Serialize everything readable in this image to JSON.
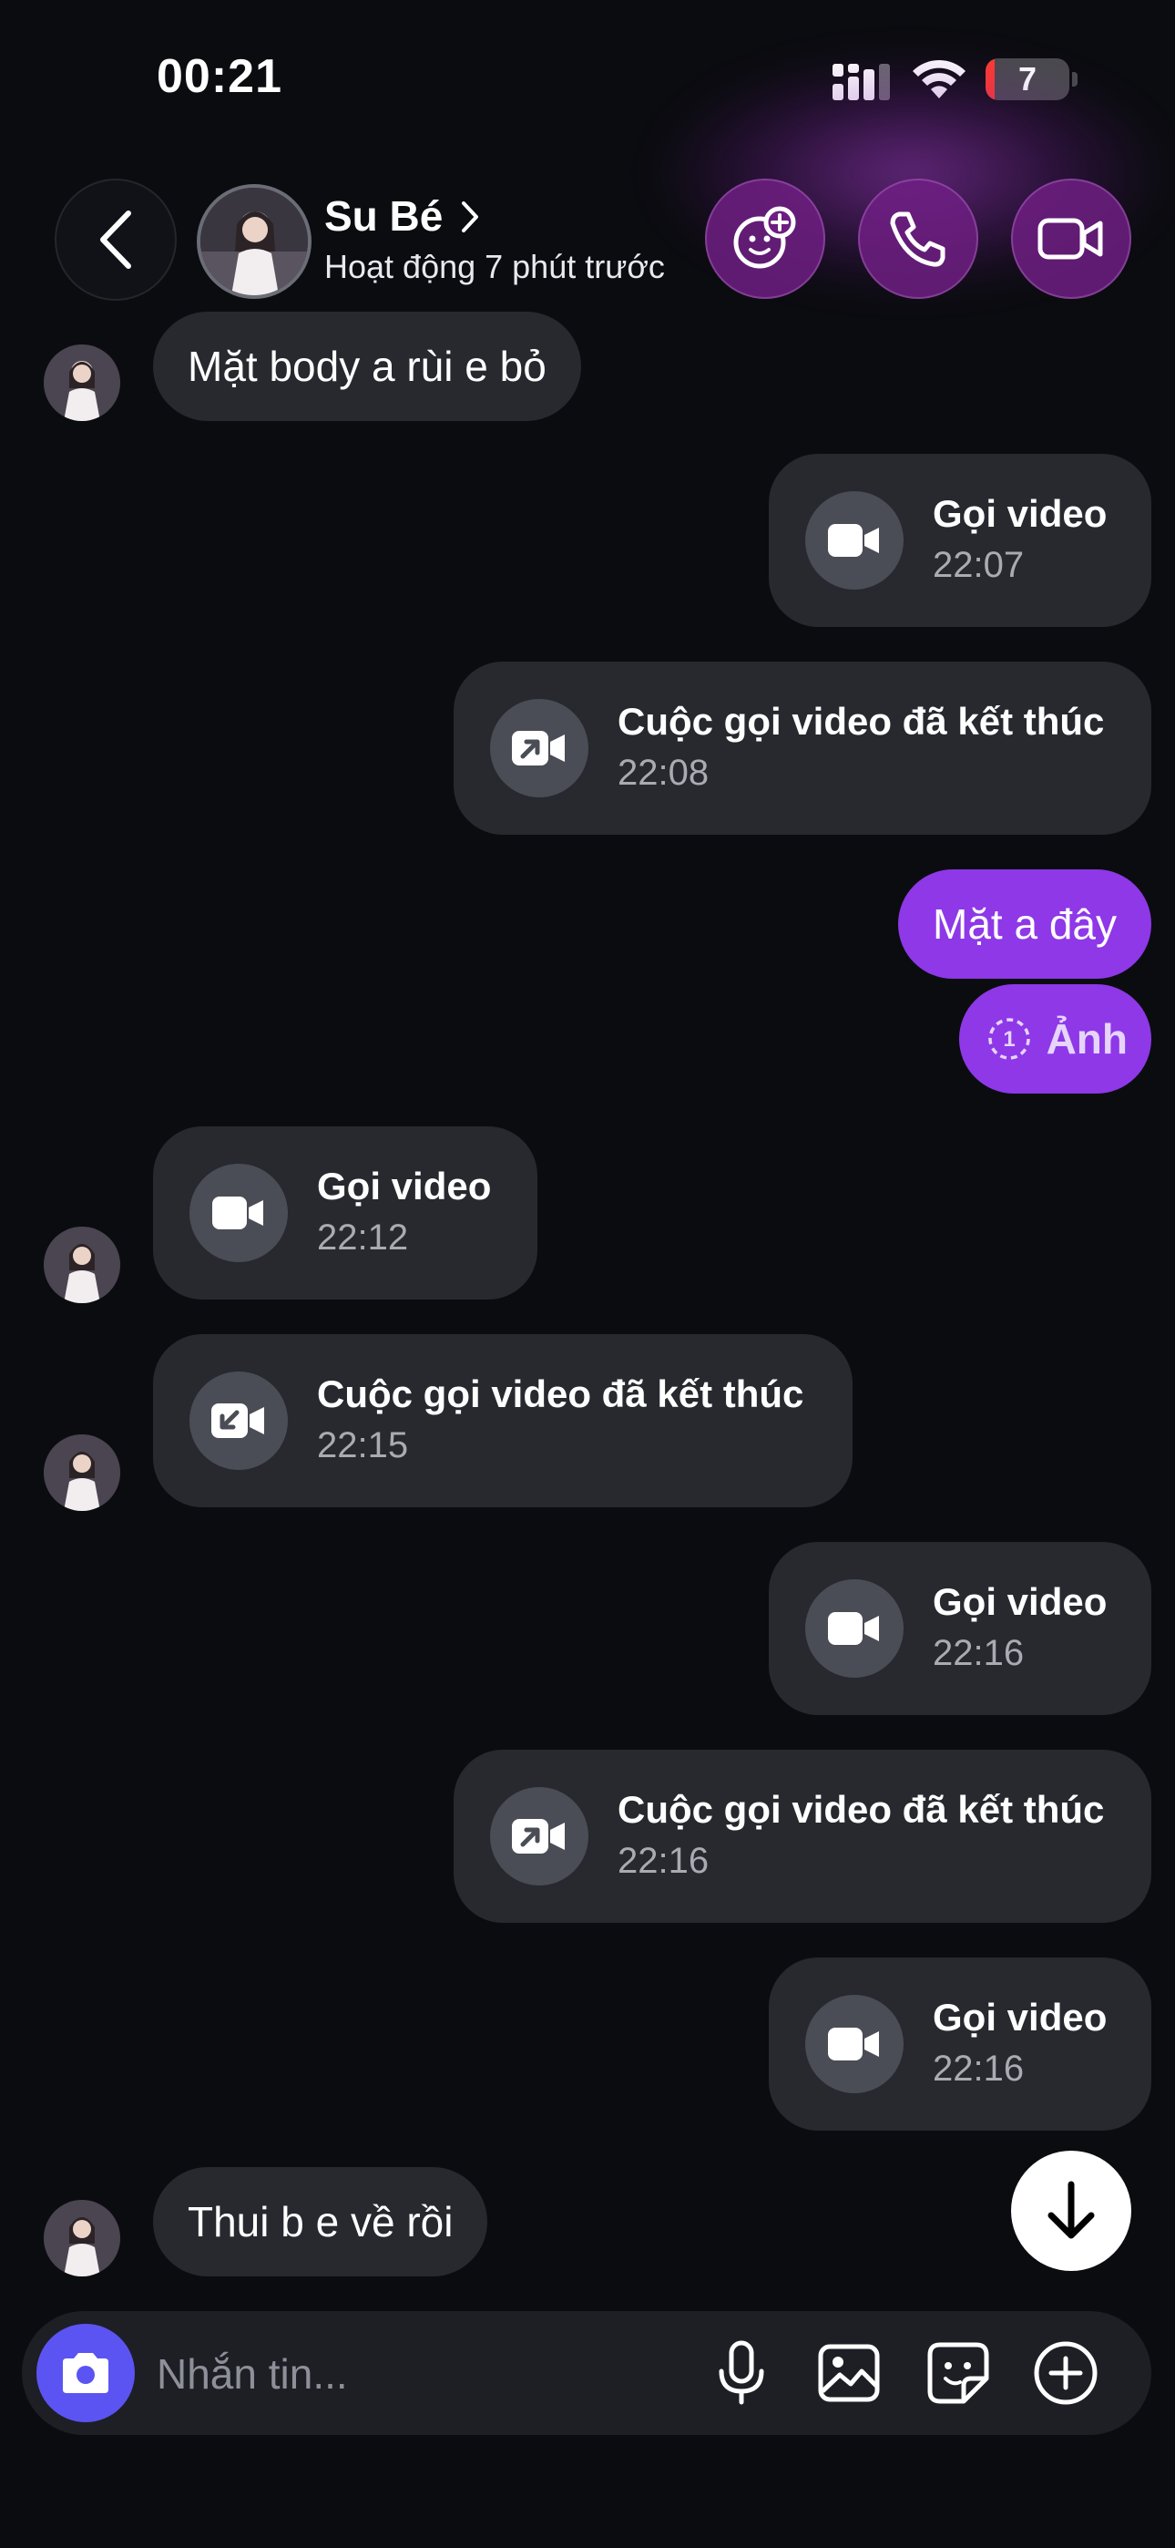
{
  "status_bar": {
    "time": "00:21",
    "battery_level": "7"
  },
  "header": {
    "name": "Su Bé",
    "status": "Hoạt động 7 phút trước"
  },
  "messages": {
    "m1": {
      "text": "Mặt body a rùi e bỏ"
    },
    "m2": {
      "title": "Gọi video",
      "time": "22:07",
      "icon": "video-camera-icon"
    },
    "m3": {
      "title": "Cuộc gọi video đã kết thúc",
      "time": "22:08",
      "icon": "outgoing-video-call-icon"
    },
    "m4": {
      "text": "Mặt a đây"
    },
    "m5": {
      "text": "Ảnh",
      "icon": "view-once-icon"
    },
    "m6": {
      "title": "Gọi video",
      "time": "22:12",
      "icon": "video-camera-icon"
    },
    "m7": {
      "title": "Cuộc gọi video đã kết thúc",
      "time": "22:15",
      "icon": "incoming-video-call-icon"
    },
    "m8": {
      "title": "Gọi video",
      "time": "22:16",
      "icon": "video-camera-icon"
    },
    "m9": {
      "title": "Cuộc gọi video đã kết thúc",
      "time": "22:16",
      "icon": "outgoing-video-call-icon"
    },
    "m10": {
      "title": "Gọi video",
      "time": "22:16",
      "icon": "video-camera-icon"
    },
    "m11": {
      "text": "Thui b e về rồi"
    }
  },
  "composer": {
    "placeholder": "Nhắn tin..."
  },
  "colors": {
    "background": "#0b0c10",
    "received_bubble": "#27292f",
    "sent_bubble": "#8e38e8",
    "camera_button": "#5b54f2",
    "header_accent": "#6e1e82"
  }
}
